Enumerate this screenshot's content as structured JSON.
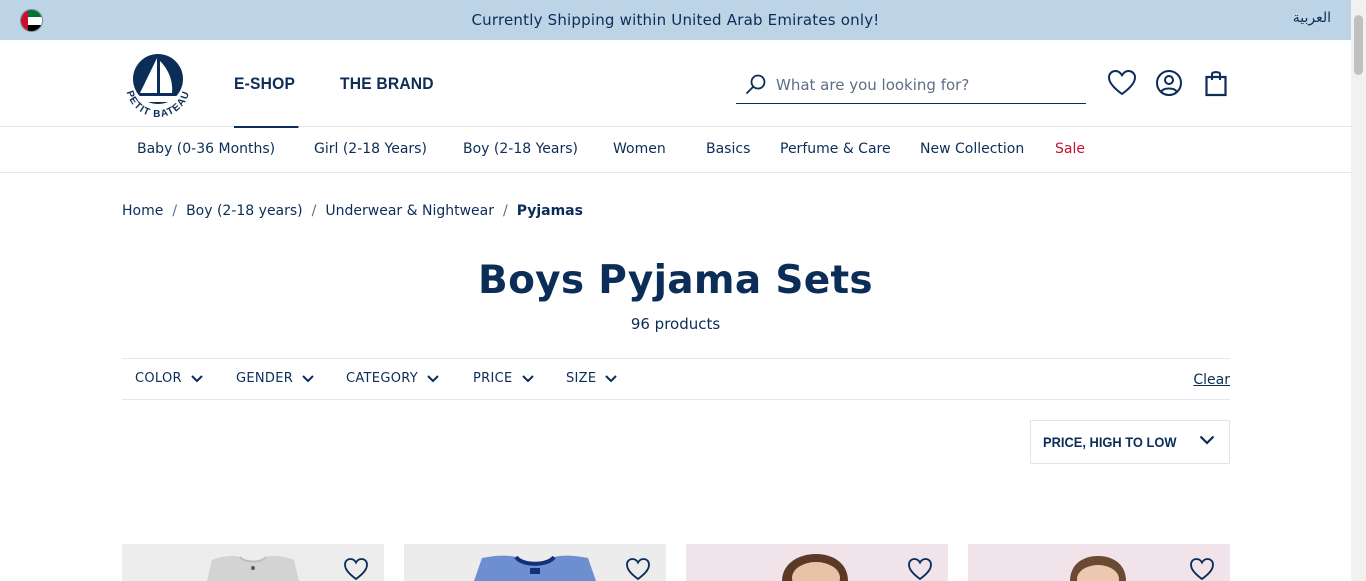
{
  "announcement": "Currently Shipping within United Arab Emirates only!",
  "language_switch": "العربية",
  "brand": "PETIT BATEAU",
  "main_nav": [
    {
      "label": "E-SHOP",
      "active": true
    },
    {
      "label": "THE BRAND",
      "active": false
    }
  ],
  "search": {
    "placeholder": "What are you looking for?"
  },
  "categories": [
    {
      "label": "Baby (0-36 Months)"
    },
    {
      "label": "Girl (2-18 Years)"
    },
    {
      "label": "Boy (2-18 Years)"
    },
    {
      "label": "Women"
    },
    {
      "label": "Basics"
    },
    {
      "label": "Perfume & Care"
    },
    {
      "label": "New Collection"
    },
    {
      "label": "Sale"
    }
  ],
  "breadcrumb": [
    "Home",
    "Boy (2-18 years)",
    "Underwear & Nightwear",
    "Pyjamas"
  ],
  "page_title": "Boys Pyjama Sets",
  "product_count": "96 products",
  "filters": [
    "COLOR",
    "GENDER",
    "CATEGORY",
    "PRICE",
    "SIZE"
  ],
  "clear_label": "Clear",
  "sort_label": "PRICE, HIGH TO LOW",
  "colors": {
    "navy": "#0b2d57",
    "topbar": "#bcd4e6",
    "sale": "#c8102e"
  }
}
